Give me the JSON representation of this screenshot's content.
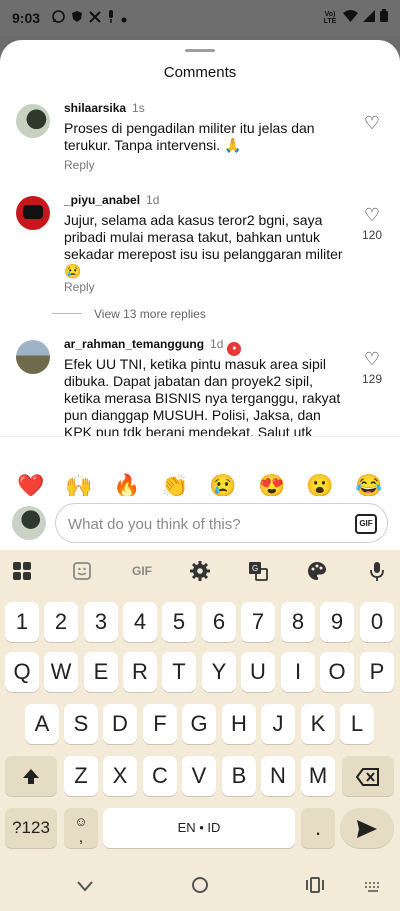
{
  "status_bar": {
    "time": "9:03",
    "lte_label": "Vo) LTE",
    "left_icons": [
      "whatsapp-icon",
      "shield-icon",
      "x-icon",
      "mic-icon",
      "dot-icon"
    ],
    "right_icons": [
      "wifi-icon",
      "signal-icon",
      "battery-icon"
    ]
  },
  "sheet": {
    "title": "Comments"
  },
  "comments": [
    {
      "username": "shilaarsika",
      "time": "1s",
      "text": "Proses di pengadilan militer itu jelas dan terukur. Tanpa intervensi. 🙏",
      "reply_label": "Reply",
      "likes": ""
    },
    {
      "username": "_piyu_anabel",
      "time": "1d",
      "text": "Jujur, selama ada kasus teror2 bgni, saya pribadi mulai merasa takut, bahkan untuk sekadar merepost isu isu pelanggaran militer 😢",
      "reply_label": "Reply",
      "likes": "120",
      "view_more": "View 13 more replies"
    },
    {
      "username": "ar_rahman_temanggung",
      "time": "1d",
      "text": "Efek UU TNI, ketika pintu masuk area sipil dibuka. Dapat jabatan dan proyek2 sipil, ketika merasa BISNIS nya terganggu, rakyat pun dianggap MUSUH. Polisi, Jaksa, dan KPK pun tdk berani mendekat. Salut utk Andrie Yunus yg berani bersuara. Jadi ini bukan tentang keamanan negara.",
      "likes": "129"
    }
  ],
  "reactions": [
    "❤️",
    "🙌",
    "🔥",
    "👏",
    "😢",
    "😍",
    "😮",
    "😂"
  ],
  "composer": {
    "placeholder": "What do you think of this?",
    "gif_label": "GIF"
  },
  "keyboard": {
    "toolbar": {
      "gif_label": "GIF",
      "icons": [
        "apps-icon",
        "sticker-icon",
        "gif-icon",
        "settings-icon",
        "translate-icon",
        "palette-icon",
        "mic-icon"
      ]
    },
    "number_row": [
      "1",
      "2",
      "3",
      "4",
      "5",
      "6",
      "7",
      "8",
      "9",
      "0"
    ],
    "row1": [
      "Q",
      "W",
      "E",
      "R",
      "T",
      "Y",
      "U",
      "I",
      "O",
      "P"
    ],
    "row2": [
      "A",
      "S",
      "D",
      "F",
      "G",
      "H",
      "J",
      "K",
      "L"
    ],
    "row3": [
      "Z",
      "X",
      "C",
      "V",
      "B",
      "N",
      "M"
    ],
    "symbols_label": "?123",
    "space_label": "EN • ID",
    "period_label": ".",
    "comma_emoji_label": ","
  },
  "nav_bar": {
    "icons": [
      "back-chevron-icon",
      "home-circle-icon",
      "recents-icon",
      "keyboard-switch-icon"
    ]
  }
}
